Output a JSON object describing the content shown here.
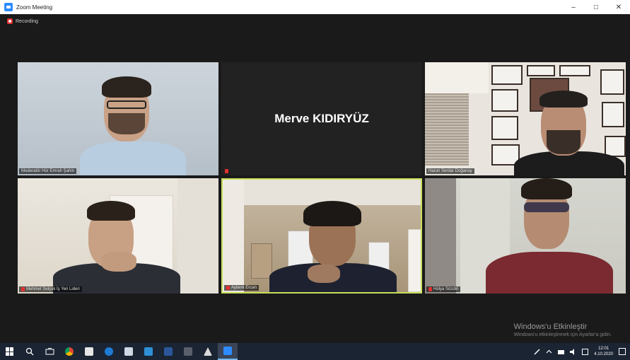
{
  "window": {
    "title": "Zoom Meeting",
    "controls": {
      "minimize": "–",
      "maximize": "□",
      "close": "✕"
    }
  },
  "recording": {
    "label": "Recording"
  },
  "participants": [
    {
      "name": "Moderatör Hür Emrah Şahin",
      "muted": false
    },
    {
      "name": "Merve KIDIRYÜZ",
      "muted": true,
      "video_off": true
    },
    {
      "name": "Harun Serdar Doğanay",
      "muted": false
    },
    {
      "name": "Mehmet Selçuk İş Yeri Lideri",
      "muted": true
    },
    {
      "name": "Ayberk Ercan",
      "muted": true,
      "active_speaker": true
    },
    {
      "name": "Hülya Sözdiri",
      "muted": true
    }
  ],
  "activation": {
    "title": "Windows'u Etkinleştir",
    "subtitle": "Windows'u etkinleştirmek için Ayarlar'a gidin."
  },
  "taskbar": {
    "apps": [
      "start-icon",
      "search-icon",
      "task-view-icon",
      "chrome-icon",
      "store-icon",
      "edge-icon",
      "mail-icon",
      "file-explorer-icon",
      "word-icon",
      "media-icon",
      "acrobat-icon",
      "zoom-icon"
    ],
    "clock": {
      "time": "12:01",
      "date": "4.10.2020"
    }
  },
  "colors": {
    "active_speaker_border": "#c8e05a",
    "recording": "#e0312f",
    "taskbar": "#1b2433"
  }
}
